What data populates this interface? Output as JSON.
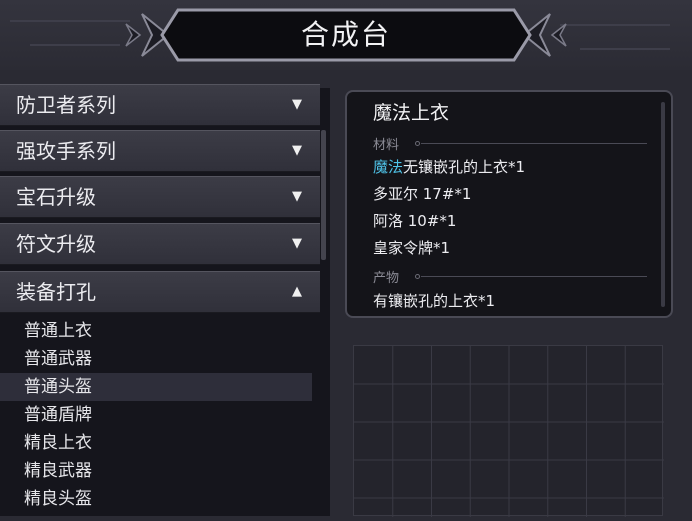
{
  "header": {
    "title": "合成台"
  },
  "categories": [
    {
      "label": "防卫者系列",
      "arrow": "▼"
    },
    {
      "label": "强攻手系列",
      "arrow": "▼"
    },
    {
      "label": "宝石升级",
      "arrow": "▼"
    },
    {
      "label": "符文升级",
      "arrow": "▼"
    },
    {
      "label": "装备打孔",
      "arrow": "▲"
    }
  ],
  "sub_items": [
    {
      "label": "普通上衣"
    },
    {
      "label": "普通武器"
    },
    {
      "label": "普通头盔"
    },
    {
      "label": "普通盾牌"
    },
    {
      "label": "精良上衣"
    },
    {
      "label": "精良武器"
    },
    {
      "label": "精良头盔"
    }
  ],
  "selected_sub_item": "普通头盔",
  "detail": {
    "title": "魔法上衣",
    "materials_label": "材料",
    "materials": [
      {
        "highlight": "魔法",
        "rest": "无镶嵌孔的上衣*1"
      },
      {
        "highlight": "",
        "rest": "多亚尔 17#*1"
      },
      {
        "highlight": "",
        "rest": "阿洛 10#*1"
      },
      {
        "highlight": "",
        "rest": "皇家令牌*1"
      }
    ],
    "product_label": "产物",
    "product": "有镶嵌孔的上衣*1"
  },
  "colors": {
    "highlight": "#4fc3e8",
    "background": "#2a2a33",
    "panel": "#15151c"
  }
}
